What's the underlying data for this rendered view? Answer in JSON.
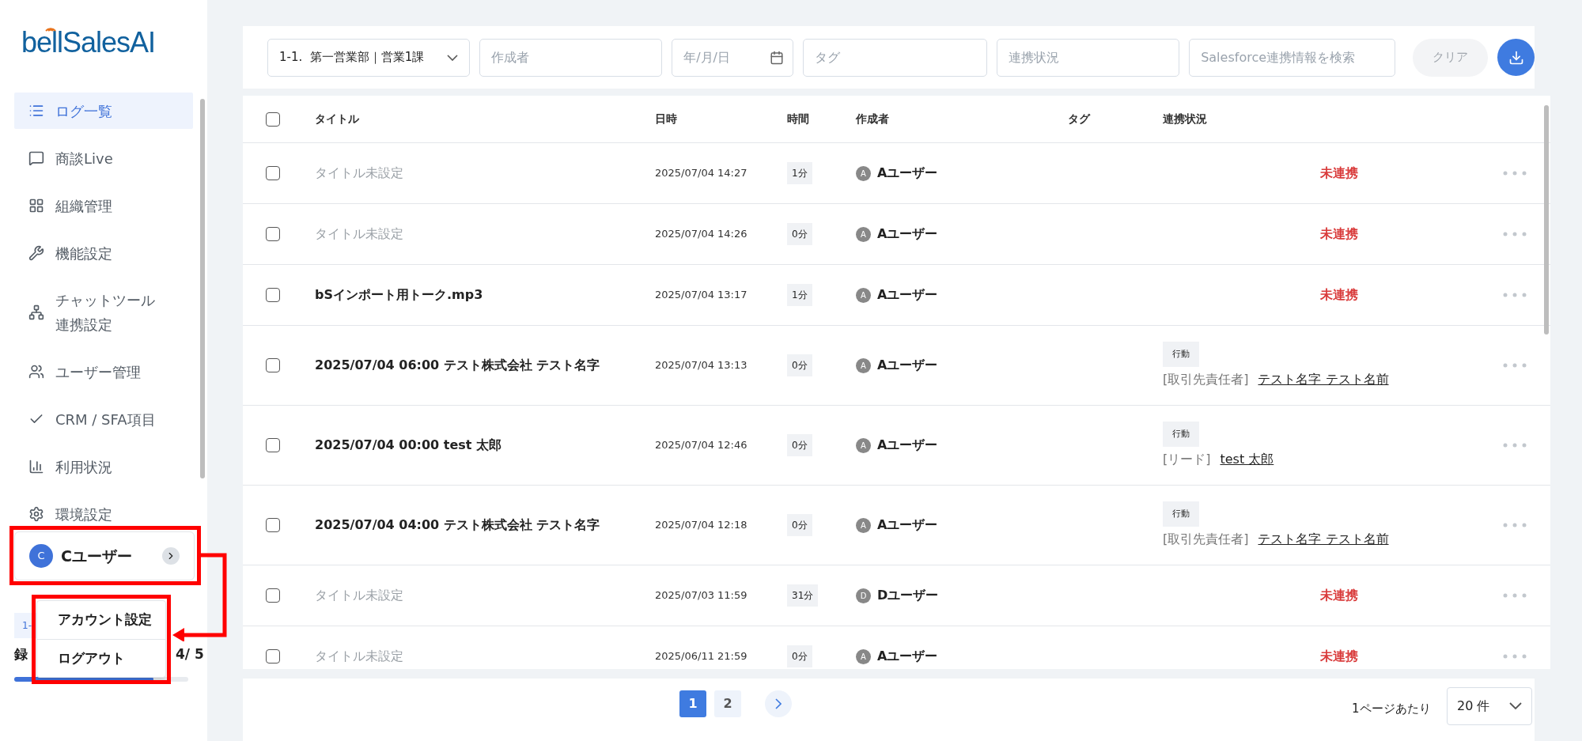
{
  "logo": "bellSalesAI",
  "sidebar": {
    "items": [
      {
        "kind": "list",
        "label": "ログ一覧",
        "selected": true
      },
      {
        "kind": "live",
        "label": "商談Live",
        "selected": false
      },
      {
        "kind": "grid",
        "label": "組織管理",
        "selected": false
      },
      {
        "kind": "wrench",
        "label": "機能設定",
        "selected": false
      },
      {
        "kind": "network",
        "label": "チャットツール連携設定",
        "selected": false
      },
      {
        "kind": "users",
        "label": "ユーザー管理",
        "selected": false
      },
      {
        "kind": "check",
        "label": "CRM / SFA項目",
        "selected": false
      },
      {
        "kind": "chart",
        "label": "利用状況",
        "selected": false
      },
      {
        "kind": "gear",
        "label": "環境設定",
        "selected": false
      }
    ],
    "user": {
      "initial": "C",
      "name": "Cユーザー"
    },
    "user_menu": [
      "アカウント設定",
      "ログアウト"
    ],
    "plan_badge": "1-",
    "usage_label": "録",
    "usage_count": "4/ 5",
    "usage": {
      "level": 0.8
    }
  },
  "filters": {
    "department": "1-1.  第一営業部｜営業1課",
    "author": {
      "placeholder": "作成者"
    },
    "date": {
      "placeholder": "年/月/日"
    },
    "tag": {
      "placeholder": "タグ"
    },
    "status": {
      "placeholder": "連携状況"
    },
    "salesforce": {
      "placeholder": "Salesforce連携情報を検索"
    },
    "clear": "クリア"
  },
  "table": {
    "select_all": false,
    "columns": [
      "タイトル",
      "日時",
      "時間",
      "作成者",
      "タグ",
      "連携状況"
    ],
    "rows": [
      {
        "checked": false,
        "title": "タイトル未設定",
        "untitled": true,
        "datetime": "2025/07/04 14:27",
        "duration": "1分",
        "initial": "A",
        "author": "Aユーザー",
        "status": {
          "kind": "unlinked",
          "text": "未連携"
        }
      },
      {
        "checked": false,
        "title": "タイトル未設定",
        "untitled": true,
        "datetime": "2025/07/04 14:26",
        "duration": "0分",
        "initial": "A",
        "author": "Aユーザー",
        "status": {
          "kind": "unlinked",
          "text": "未連携"
        }
      },
      {
        "checked": false,
        "title": "bSインポート用トーク.mp3",
        "untitled": false,
        "datetime": "2025/07/04 13:17",
        "duration": "1分",
        "initial": "A",
        "author": "Aユーザー",
        "status": {
          "kind": "unlinked",
          "text": "未連携"
        }
      },
      {
        "checked": false,
        "title": "2025/07/04 06:00 テスト株式会社 テスト名字",
        "untitled": false,
        "datetime": "2025/07/04 13:13",
        "duration": "0分",
        "initial": "A",
        "author": "Aユーザー",
        "status": {
          "kind": "linked",
          "tag": "行動",
          "role": "[取引先責任者]",
          "name": "テスト名字 テスト名前"
        }
      },
      {
        "checked": false,
        "title": "2025/07/04 00:00 test 太郎",
        "untitled": false,
        "datetime": "2025/07/04 12:46",
        "duration": "0分",
        "initial": "A",
        "author": "Aユーザー",
        "status": {
          "kind": "linked",
          "tag": "行動",
          "role": "[リード]",
          "name": "test 太郎"
        }
      },
      {
        "checked": false,
        "title": "2025/07/04 04:00 テスト株式会社 テスト名字",
        "untitled": false,
        "datetime": "2025/07/04 12:18",
        "duration": "0分",
        "initial": "A",
        "author": "Aユーザー",
        "status": {
          "kind": "linked",
          "tag": "行動",
          "role": "[取引先責任者]",
          "name": "テスト名字 テスト名前"
        }
      },
      {
        "checked": false,
        "title": "タイトル未設定",
        "untitled": true,
        "datetime": "2025/07/03 11:59",
        "duration": "31分",
        "initial": "D",
        "author": "Dユーザー",
        "status": {
          "kind": "unlinked",
          "text": "未連携"
        }
      },
      {
        "checked": false,
        "title": "タイトル未設定",
        "untitled": true,
        "datetime": "2025/06/11 21:59",
        "duration": "0分",
        "initial": "A",
        "author": "Aユーザー",
        "status": {
          "kind": "unlinked",
          "text": "未連携"
        }
      }
    ]
  },
  "pagination": {
    "pages": [
      {
        "label": "1",
        "selected": true
      },
      {
        "label": "2",
        "selected": false
      }
    ],
    "per_page_label": "1ページあたり",
    "per_page": "20 件"
  }
}
